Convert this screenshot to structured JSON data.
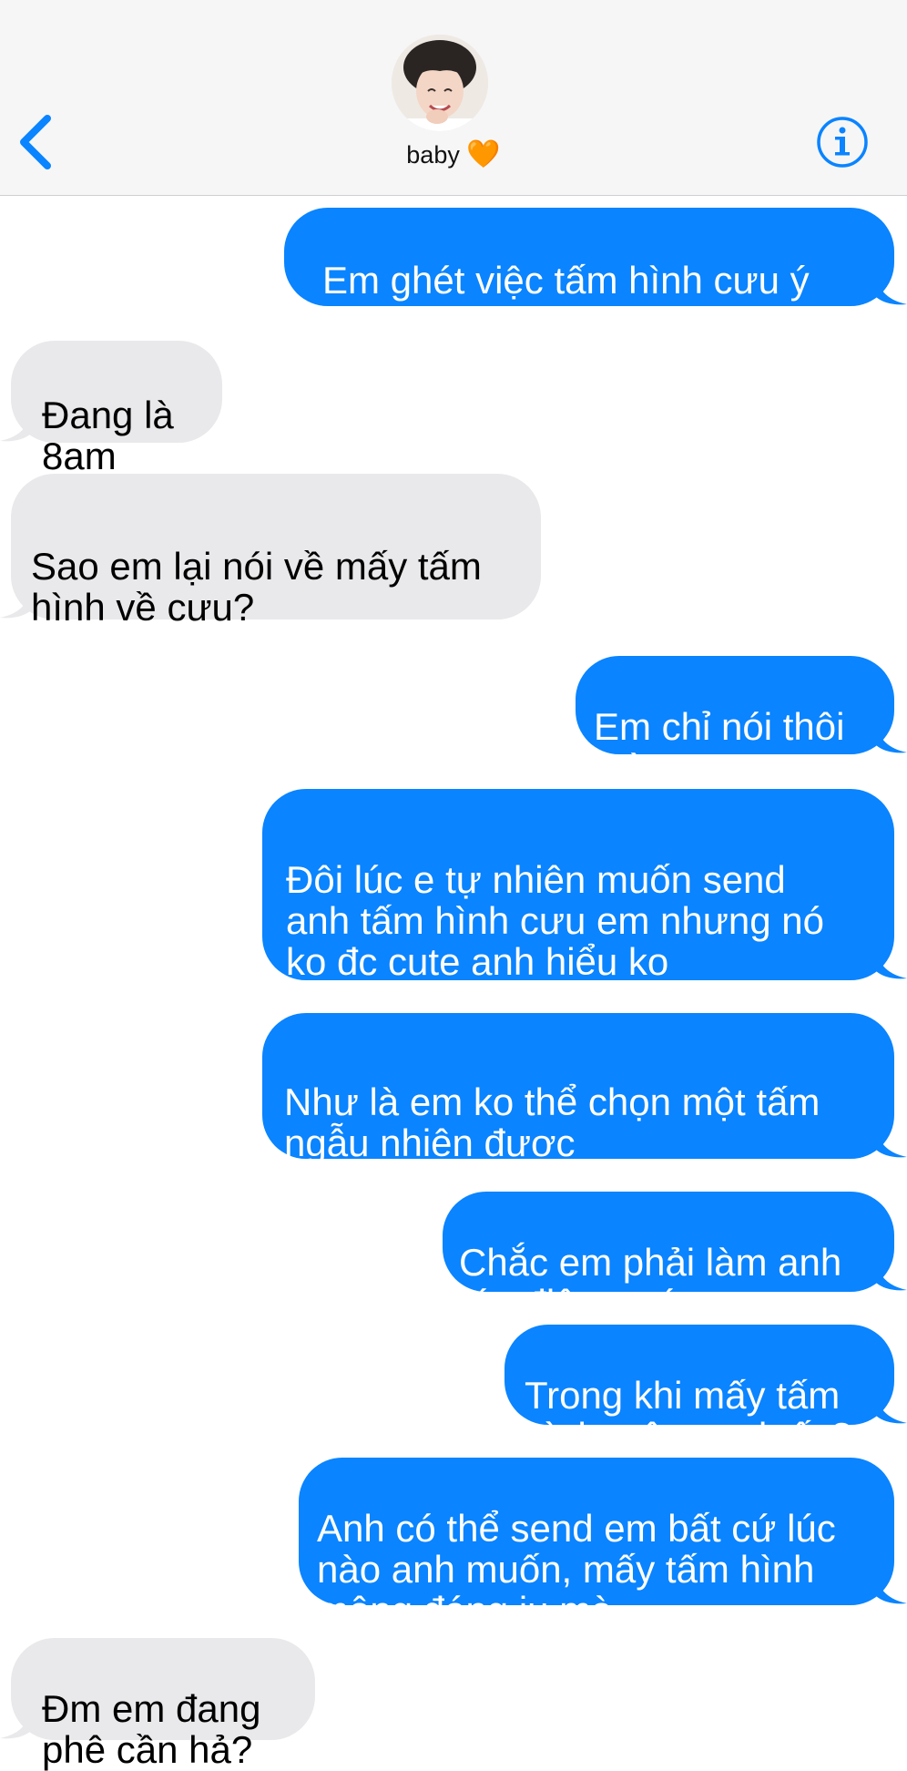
{
  "header": {
    "back_icon": "chevron-left-icon",
    "contact_name": "baby",
    "contact_emoji": "🧡",
    "info_icon": "info-icon",
    "accent_color": "#0a84ff"
  },
  "messages": [
    {
      "direction": "outgoing",
      "text": "Em ghét việc tấm hình cưu ý\nko đc cute"
    },
    {
      "direction": "incoming",
      "text": "Đang là\n8am"
    },
    {
      "direction": "incoming",
      "text": "Sao em lại nói về mấy tấm\nhình về cưu?"
    },
    {
      "direction": "outgoing",
      "text": "Em chỉ nói thôi\nmà"
    },
    {
      "direction": "outgoing",
      "text": "Đôi lúc e tự nhiên muốn send\nanh tấm hình cưu em nhưng nó\nko đc cute anh hiểu ko"
    },
    {
      "direction": "outgoing",
      "text": "Như là em ko thể chọn một tấm\nngẫu nhiên được"
    },
    {
      "direction": "outgoing",
      "text": "Chắc em phải làm anh\ntức điên trước"
    },
    {
      "direction": "outgoing",
      "text": "Trong khi mấy tấm\nhình mông anh ấy?"
    },
    {
      "direction": "outgoing",
      "text": "Anh có thể send em bất cứ lúc\nnào anh muốn, mấy tấm hình\nmông đáng iu mà"
    },
    {
      "direction": "incoming",
      "text": "Đm em đang\nphê cần hả?"
    }
  ],
  "colors": {
    "outgoing_bubble": "#0a84ff",
    "incoming_bubble": "#e9e9eb"
  }
}
